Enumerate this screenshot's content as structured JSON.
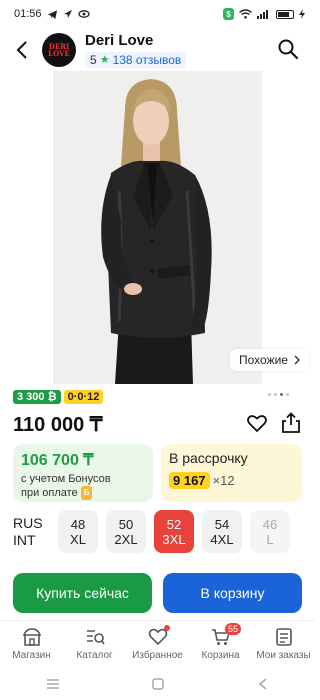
{
  "status_bar": {
    "time": "01:56"
  },
  "header": {
    "shop_name": "Deri Love",
    "rating": "5",
    "reviews": "138 отзывов",
    "logo_text": [
      "DERI",
      "LOVE"
    ]
  },
  "product": {
    "similar_label": "Похожие",
    "badges": {
      "points": "3 300 ₿",
      "installment": "0·0·12"
    },
    "price": "110 000 ₸",
    "image_dots": {
      "total": 4,
      "active": 2
    }
  },
  "bonus_card": {
    "price": "106 700 ₸",
    "note_line1": "с учетом Бонусов",
    "note_line2": "при оплате"
  },
  "installment_card": {
    "title": "В рассрочку",
    "amount": "9 167",
    "multiplier": "×12"
  },
  "sizes": {
    "system": [
      "RUS",
      "INT"
    ],
    "options": [
      {
        "rus": "48",
        "int": "XL",
        "state": "normal"
      },
      {
        "rus": "50",
        "int": "2XL",
        "state": "normal"
      },
      {
        "rus": "52",
        "int": "3XL",
        "state": "selected"
      },
      {
        "rus": "54",
        "int": "4XL",
        "state": "normal"
      },
      {
        "rus": "46",
        "int": "L",
        "state": "disabled"
      }
    ]
  },
  "actions": {
    "buy_now": "Купить сейчас",
    "to_cart": "В корзину"
  },
  "tabbar": {
    "items": [
      {
        "label": "Магазин",
        "icon": "shop-icon"
      },
      {
        "label": "Каталог",
        "icon": "catalog-icon"
      },
      {
        "label": "Избранное",
        "icon": "heart-icon"
      },
      {
        "label": "Корзина",
        "icon": "cart-icon",
        "badge": "55"
      },
      {
        "label": "Мои заказы",
        "icon": "orders-icon"
      }
    ]
  },
  "colors": {
    "green": "#1b9a45",
    "blue": "#1b63d9",
    "red": "#e8433a",
    "yellow": "#ffd21f"
  }
}
